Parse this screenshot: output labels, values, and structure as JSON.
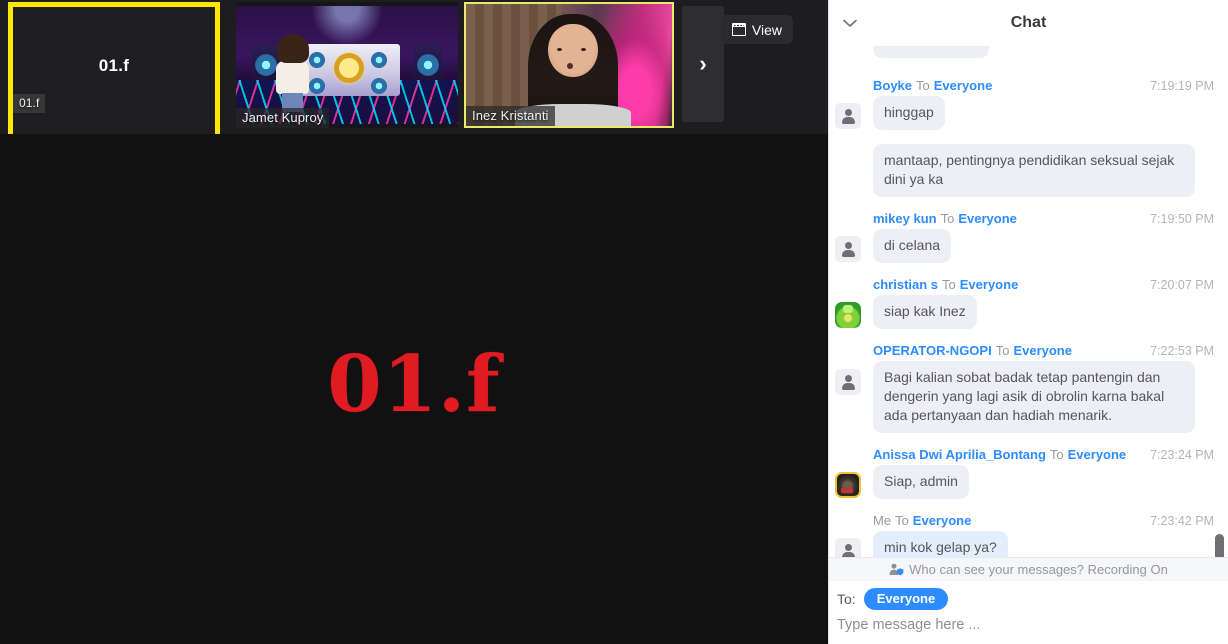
{
  "stage": {
    "view_button": {
      "label": "View",
      "icon": "layout-grid-icon"
    },
    "next_button": {
      "icon": "chevron-right-icon"
    },
    "main_speaker_label": "01.f",
    "thumbnails": [
      {
        "name": "01.f",
        "center_label": "01.f",
        "active": true
      },
      {
        "name": "Jamet Kuproy",
        "active": false
      },
      {
        "name": "Inez Kristanti",
        "active": true
      }
    ]
  },
  "chat": {
    "title": "Chat",
    "collapse_icon": "chevron-down-icon",
    "to_word": "To",
    "messages": [
      {
        "sender": "Boyke",
        "target": "Everyone",
        "time": "7:19:19 PM",
        "text": "hinggap",
        "avatar": "generic",
        "mine": false
      },
      {
        "sender": "",
        "target": "",
        "time": "",
        "text": "mantaap, pentingnya pendidikan seksual sejak dini ya ka",
        "avatar": "none",
        "mine": false
      },
      {
        "sender": "mikey kun",
        "target": "Everyone",
        "time": "7:19:50 PM",
        "text": "di celana",
        "avatar": "generic",
        "mine": false
      },
      {
        "sender": "christian s",
        "target": "Everyone",
        "time": "7:20:07 PM",
        "text": "siap kak Inez",
        "avatar": "img-green",
        "mine": false
      },
      {
        "sender": "OPERATOR-NGOPI",
        "target": "Everyone",
        "time": "7:22:53 PM",
        "text": "Bagi kalian sobat badak tetap pantengin dan dengerin yang lagi asik di obrolin karna bakal ada pertanyaan dan hadiah menarik.",
        "avatar": "generic",
        "mine": false
      },
      {
        "sender": "Anissa Dwi Aprilia_Bontang",
        "target": "Everyone",
        "time": "7:23:24 PM",
        "text": "Siap, admin",
        "avatar": "img-photo",
        "mine": false
      },
      {
        "sender": "Me",
        "target": "Everyone",
        "time": "7:23:42 PM",
        "text": "min kok gelap ya?",
        "avatar": "generic",
        "mine": true
      }
    ],
    "privacy_notice": "Who can see your messages? Recording On",
    "privacy_icon": "person-shield-icon",
    "compose": {
      "to_label": "To:",
      "to_chip": "Everyone",
      "placeholder": "Type message here ..."
    }
  },
  "colors": {
    "accent_blue": "#2d8cff",
    "active_border_yellow": "#ffe800",
    "speaking_border_yellow": "#e9e96b",
    "stage_background": "#111112",
    "bubble_gray": "#eeeff4",
    "bubble_mine_blue": "#e2eefb",
    "main_label_red": "#e01b22"
  }
}
